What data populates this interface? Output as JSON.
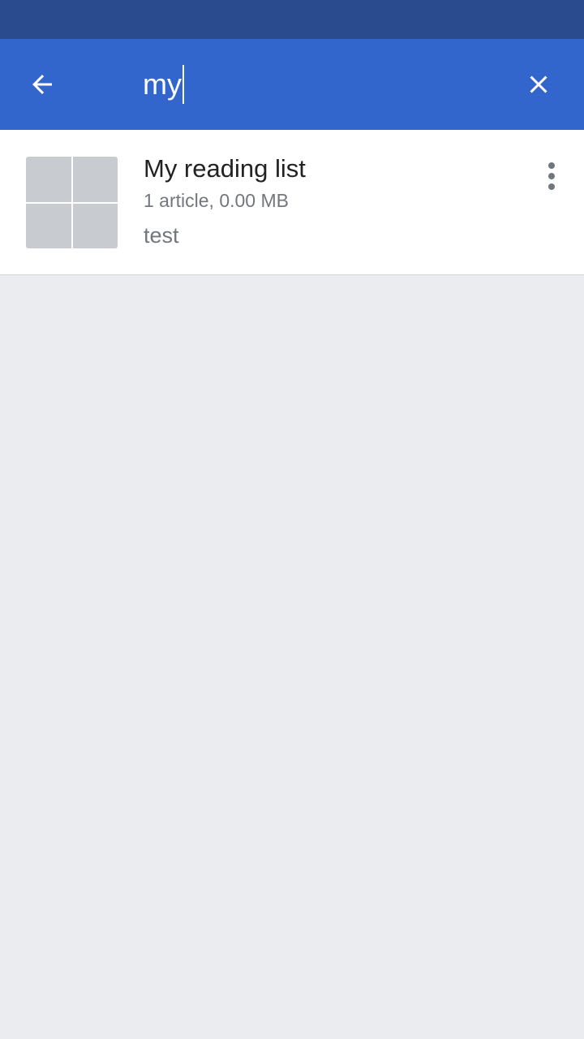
{
  "colors": {
    "status_bar": "#2A4B8D",
    "toolbar": "#3366CC",
    "background": "#EAECF0",
    "thumb_tile": "#C8CCD1"
  },
  "toolbar": {
    "back_icon": "arrow-left-icon",
    "search_value": "my",
    "close_icon": "close-icon"
  },
  "results": [
    {
      "title": "My reading list",
      "meta": "1 article, 0.00 MB",
      "description": "test",
      "menu_icon": "more-vertical-icon"
    }
  ]
}
